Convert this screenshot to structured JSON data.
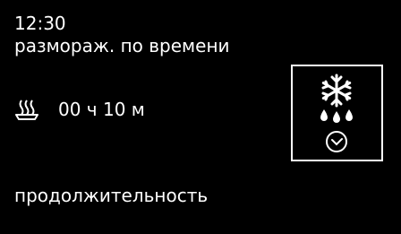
{
  "status": {
    "clock": "12:30",
    "mode": "размораж. по времени"
  },
  "setting": {
    "duration": "00 ч 10 м",
    "icon": "pan-heat-icon"
  },
  "panel": {
    "icons": [
      "snowflake-icon",
      "water-drops-icon",
      "clock-icon"
    ]
  },
  "footer": {
    "label": "продолжительность"
  }
}
